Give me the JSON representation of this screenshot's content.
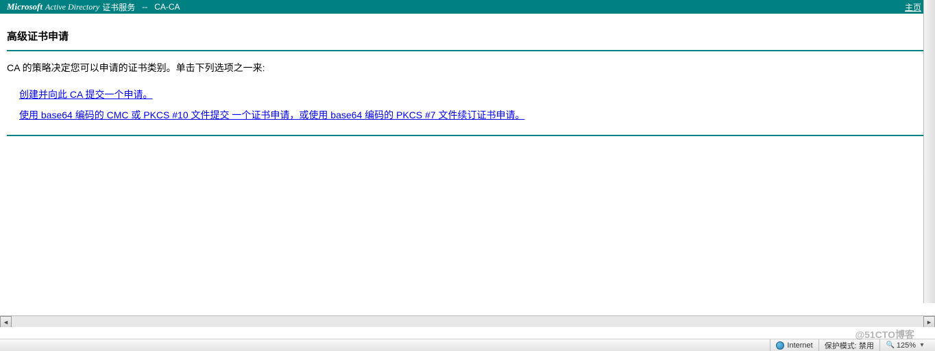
{
  "header": {
    "brand": "Microsoft",
    "service": "Active Directory",
    "service_cn": "证书服务",
    "separator": "--",
    "ca_name": "CA-CA",
    "home_link": "主页"
  },
  "page": {
    "title": "高级证书申请",
    "instruction": "CA 的策略决定您可以申请的证书类别。单击下列选项之一来:"
  },
  "links": {
    "option1": "创建并向此 CA 提交一个申请。",
    "option2": "使用 base64 编码的 CMC 或 PKCS #10 文件提交 一个证书申请，或使用 base64 编码的 PKCS #7 文件续订证书申请。"
  },
  "statusbar": {
    "zone": "Internet",
    "protected_mode": "保护模式: 禁用",
    "zoom": "125%"
  },
  "watermark": "@51CTO博客",
  "scroll": {
    "left_arrow": "◄",
    "right_arrow": "►"
  }
}
